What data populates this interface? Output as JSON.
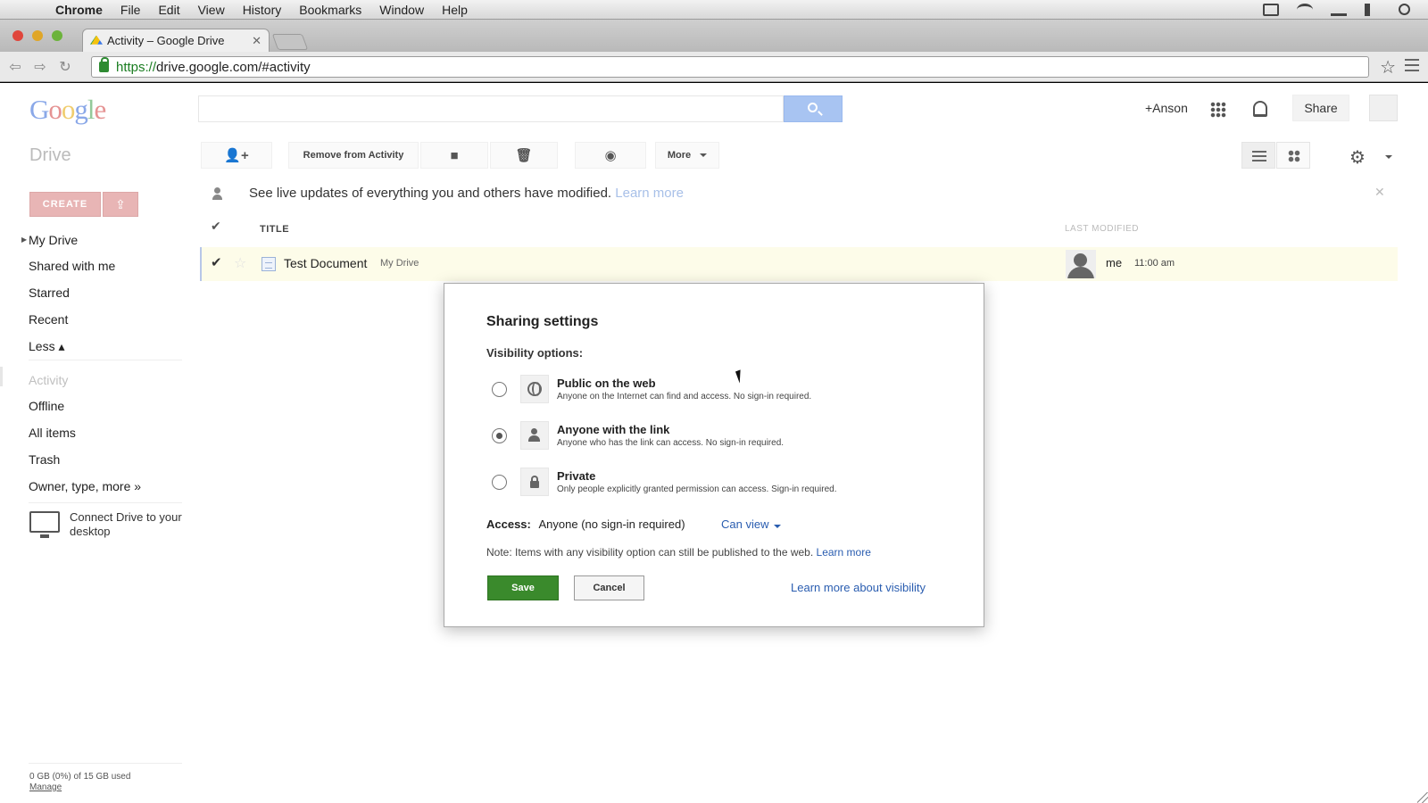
{
  "menubar": {
    "app": "Chrome",
    "items": [
      "File",
      "Edit",
      "View",
      "History",
      "Bookmarks",
      "Window",
      "Help"
    ]
  },
  "browser": {
    "tab_title": "Activity – Google Drive",
    "url_scheme": "https://",
    "url_rest": "drive.google.com/#activity"
  },
  "header": {
    "logo_letters": [
      "G",
      "o",
      "o",
      "g",
      "l",
      "e"
    ],
    "search_placeholder": "",
    "user": "+Anson",
    "share_label": "Share"
  },
  "drive_label": "Drive",
  "toolbar": {
    "remove_label": "Remove from Activity",
    "more_label": "More"
  },
  "sidebar": {
    "create_label": "CREATE",
    "items": [
      {
        "label": "My Drive"
      },
      {
        "label": "Shared with me"
      },
      {
        "label": "Starred"
      },
      {
        "label": "Recent"
      },
      {
        "label": "Less ▴"
      },
      {
        "label": "Activity"
      },
      {
        "label": "Offline"
      },
      {
        "label": "All items"
      },
      {
        "label": "Trash"
      },
      {
        "label": "Owner, type, more »"
      }
    ],
    "connect_text": "Connect Drive to your desktop",
    "storage_text": "0 GB (0%) of 15 GB used",
    "manage_label": "Manage"
  },
  "banner": {
    "text": "See live updates of everything you and others have modified.",
    "link": "Learn more"
  },
  "list": {
    "col_title": "TITLE",
    "col_modified": "LAST MODIFIED",
    "rows": [
      {
        "title": "Test Document",
        "location": "My Drive",
        "owner": "me",
        "time": "11:00 am"
      }
    ]
  },
  "dialog": {
    "title": "Sharing settings",
    "subtitle": "Visibility options:",
    "options": [
      {
        "label": "Public on the web",
        "desc": "Anyone on the Internet can find and access. No sign-in required.",
        "checked": false,
        "icon": "globe-icon"
      },
      {
        "label": "Anyone with the link",
        "desc": "Anyone who has the link can access. No sign-in required.",
        "checked": true,
        "icon": "person-icon"
      },
      {
        "label": "Private",
        "desc": "Only people explicitly granted permission can access. Sign-in required.",
        "checked": false,
        "icon": "lock-icon"
      }
    ],
    "access_label": "Access:",
    "access_value": "Anyone (no sign-in required)",
    "permission": "Can view",
    "note": "Note: Items with any visibility option can still be published to the web.",
    "note_link": "Learn more",
    "save_label": "Save",
    "cancel_label": "Cancel",
    "learn_visibility": "Learn more about visibility"
  }
}
